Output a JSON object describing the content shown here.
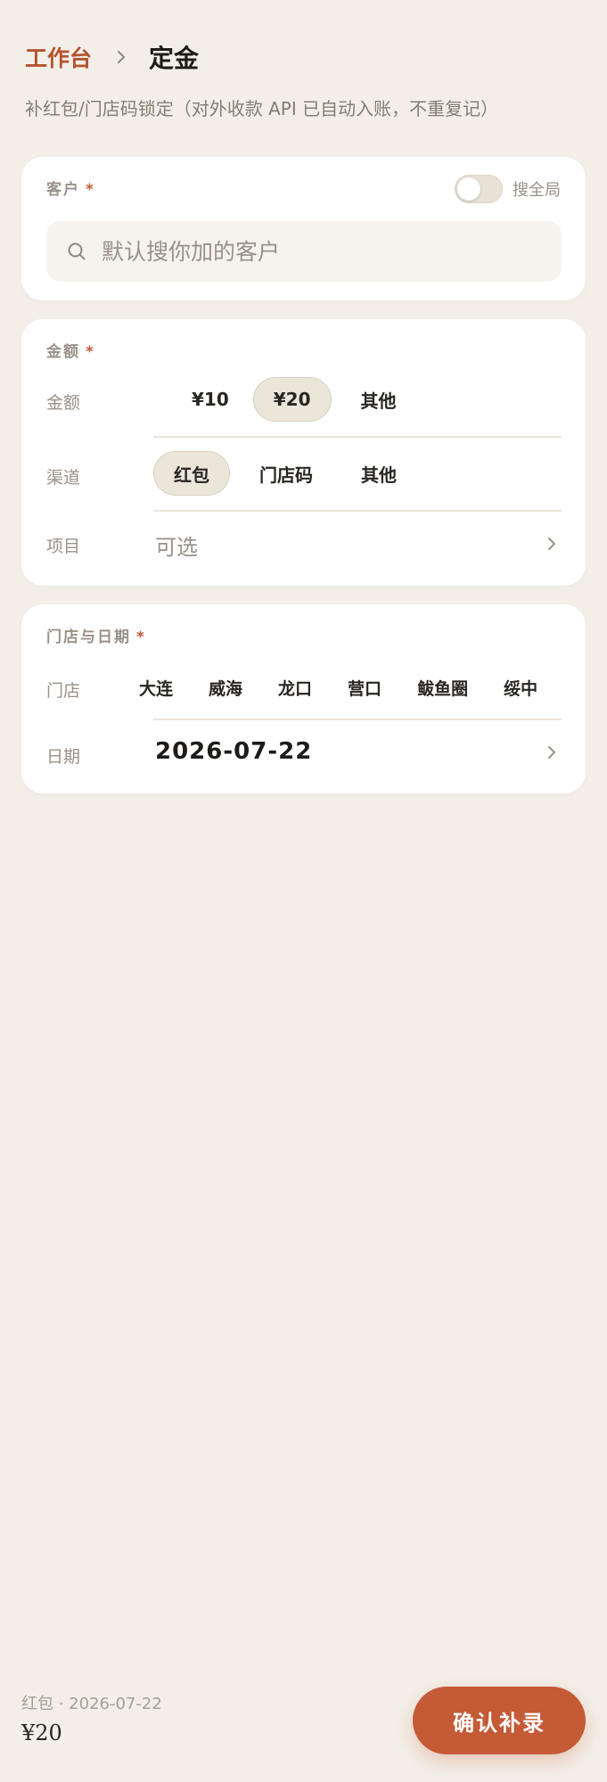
{
  "header": {
    "breadcrumb_root": "工作台",
    "title": "定金",
    "subtitle": "补红包/门店码锁定（对外收款 API 已自动入账，不重复记）"
  },
  "customer": {
    "label": "客户",
    "required_mark": "*",
    "toggle_label": "搜全局",
    "toggle_on": false,
    "search_placeholder": "默认搜你加的客户"
  },
  "amount": {
    "section_label": "金额",
    "required_mark": "*",
    "amount_label": "金额",
    "amount_options": [
      "¥10",
      "¥20",
      "其他"
    ],
    "amount_selected": "¥20",
    "channel_label": "渠道",
    "channel_options": [
      "红包",
      "门店码",
      "其他"
    ],
    "channel_selected": "红包",
    "project_label": "项目",
    "project_placeholder": "可选"
  },
  "store_date": {
    "section_label": "门店与日期",
    "required_mark": "*",
    "store_label": "门店",
    "stores": [
      "大连",
      "威海",
      "龙口",
      "营口",
      "鲅鱼圈",
      "绥中"
    ],
    "date_label": "日期",
    "date_value": "2026-07-22"
  },
  "footer": {
    "summary": "红包 · 2026-07-22",
    "total": "¥20",
    "confirm_label": "确认补录"
  },
  "colors": {
    "accent": "#c45a36",
    "background": "#f3efe8",
    "chip_selected": "#ebe6da"
  },
  "icons": {
    "breadcrumb_separator": "chevron-right-icon",
    "search": "search-icon",
    "row_chevron": "chevron-right-icon"
  }
}
